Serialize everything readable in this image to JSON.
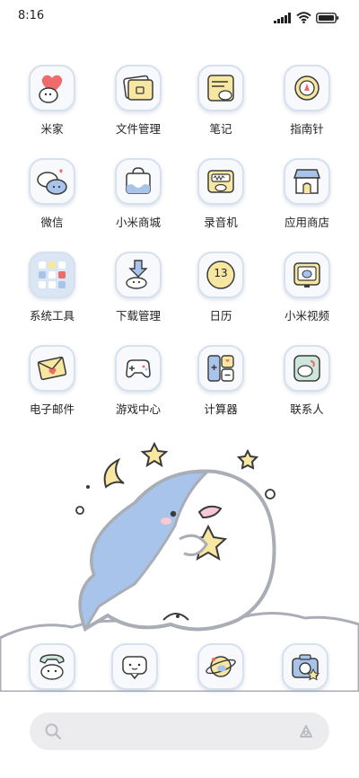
{
  "status_bar": {
    "time": "8:16"
  },
  "apps": [
    {
      "label": "米家",
      "icon": "heart-cloud-icon"
    },
    {
      "label": "文件管理",
      "icon": "folder-icon"
    },
    {
      "label": "笔记",
      "icon": "notepad-icon"
    },
    {
      "label": "指南针",
      "icon": "compass-icon"
    },
    {
      "label": "微信",
      "icon": "chat-bubbles-icon"
    },
    {
      "label": "小米商城",
      "icon": "shopping-bag-icon"
    },
    {
      "label": "录音机",
      "icon": "recorder-icon"
    },
    {
      "label": "应用商店",
      "icon": "store-icon"
    },
    {
      "label": "系统工具",
      "icon": "folder-grid-icon"
    },
    {
      "label": "下载管理",
      "icon": "download-icon"
    },
    {
      "label": "日历",
      "icon": "calendar-icon",
      "badge": "13"
    },
    {
      "label": "小米视频",
      "icon": "tv-icon"
    },
    {
      "label": "电子邮件",
      "icon": "envelope-icon"
    },
    {
      "label": "游戏中心",
      "icon": "gamepad-icon"
    },
    {
      "label": "计算器",
      "icon": "calculator-icon"
    },
    {
      "label": "联系人",
      "icon": "contacts-icon"
    }
  ],
  "dock": [
    {
      "icon": "phone-icon"
    },
    {
      "icon": "message-icon"
    },
    {
      "icon": "browser-planet-icon"
    },
    {
      "icon": "camera-icon"
    }
  ],
  "colors": {
    "tile_border": "#d6e1ee",
    "accent_blue": "#a9c4ea",
    "accent_yellow": "#f7e7a0",
    "accent_red": "#ef6a6a",
    "search_bg": "#ececee"
  }
}
